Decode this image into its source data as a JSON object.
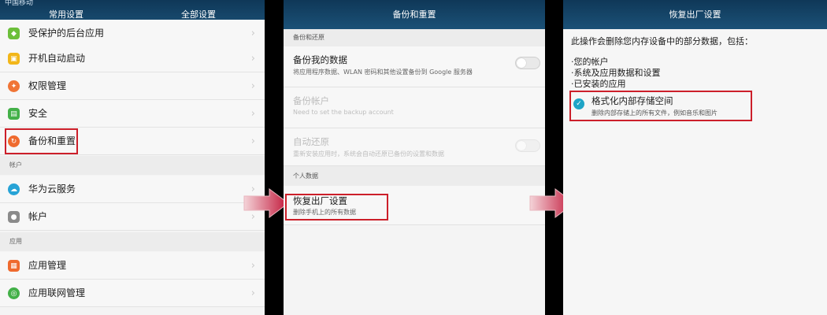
{
  "panel1": {
    "status_text": "中国移动",
    "tabs": [
      {
        "label": "常用设置"
      },
      {
        "label": "全部设置"
      }
    ],
    "items_top": [
      {
        "label": "受保护的后台应用",
        "icon": "shield-app-icon",
        "color": "#6cbf3a"
      },
      {
        "label": "开机自动启动",
        "icon": "power-on-icon",
        "color": "#f2b619"
      },
      {
        "label": "权限管理",
        "icon": "permission-icon",
        "color": "#f07536"
      },
      {
        "label": "安全",
        "icon": "lock-icon",
        "color": "#43b048"
      },
      {
        "label": "备份和重置",
        "icon": "backup-icon",
        "color": "#ef6a2e"
      }
    ],
    "section_account": "帐户",
    "items_account": [
      {
        "label": "华为云服务",
        "icon": "cloud-icon",
        "color": "#27a3d6"
      },
      {
        "label": "帐户",
        "icon": "person-icon",
        "color": "#8b8b8b"
      }
    ],
    "section_apps": "应用",
    "items_apps": [
      {
        "label": "应用管理",
        "icon": "app-grid-icon",
        "color": "#ef6a2e"
      },
      {
        "label": "应用联网管理",
        "icon": "network-icon",
        "color": "#43b048"
      }
    ]
  },
  "panel2": {
    "title": "备份和重置",
    "section_backup": "备份和还原",
    "backup_data": {
      "title": "备份我的数据",
      "sub": "将应用程序数据、WLAN 密码和其他设置备份到 Google 服务器"
    },
    "backup_account": {
      "title": "备份帐户",
      "sub": "Need to set the backup account"
    },
    "auto_restore": {
      "title": "自动还原",
      "sub": "重新安装应用时，系统会自动还原已备份的设置和数据"
    },
    "section_personal": "个人数据",
    "factory_reset": {
      "title": "恢复出厂设置",
      "sub": "删除手机上的所有数据"
    }
  },
  "panel3": {
    "title": "恢复出厂设置",
    "warning": "此操作会删除您内存设备中的部分数据，包括：",
    "bullets": [
      "·您的帐户",
      "·系统及应用数据和设置",
      "·已安装的应用"
    ],
    "format_option": {
      "title": "格式化内部存储空间",
      "sub": "删除内部存储上的所有文件，例如音乐和图片"
    }
  },
  "colors": {
    "accent_red": "#cc1f2a",
    "header_blue": "#13405f",
    "check_teal": "#1ea4c6"
  }
}
